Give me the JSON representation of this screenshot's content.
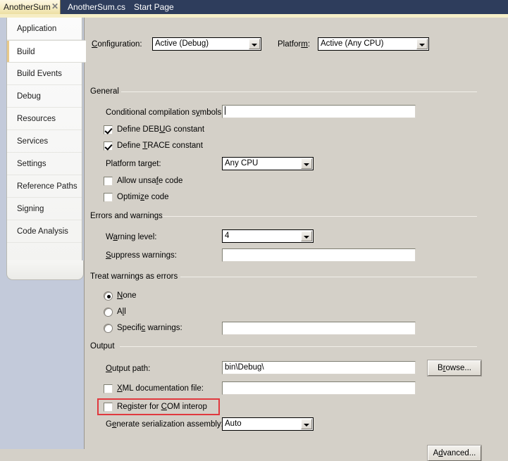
{
  "tabs": {
    "active": {
      "label": "AnotherSum",
      "close_glyph": "✕"
    },
    "others": [
      {
        "label": "AnotherSum.cs"
      },
      {
        "label": "Start Page"
      }
    ]
  },
  "sidebar": {
    "items": [
      {
        "label": "Application",
        "selected": false
      },
      {
        "label": "Build",
        "selected": true
      },
      {
        "label": "Build Events",
        "selected": false
      },
      {
        "label": "Debug",
        "selected": false
      },
      {
        "label": "Resources",
        "selected": false
      },
      {
        "label": "Services",
        "selected": false
      },
      {
        "label": "Settings",
        "selected": false
      },
      {
        "label": "Reference Paths",
        "selected": false
      },
      {
        "label": "Signing",
        "selected": false
      },
      {
        "label": "Code Analysis",
        "selected": false
      }
    ]
  },
  "config_row": {
    "configuration_label": "Configuration:",
    "configuration_value": "Active (Debug)",
    "platform_label": "Platform:",
    "platform_value": "Active (Any CPU)"
  },
  "general": {
    "header": "General",
    "conditional_symbols_label": "Conditional compilation symbols:",
    "conditional_symbols_value": "",
    "define_debug_label": "Define DEBUG constant",
    "define_debug_checked": true,
    "define_trace_label": "Define TRACE constant",
    "define_trace_checked": true,
    "platform_target_label": "Platform target:",
    "platform_target_value": "Any CPU",
    "allow_unsafe_label": "Allow unsafe code",
    "allow_unsafe_checked": false,
    "optimize_label": "Optimize code",
    "optimize_checked": false
  },
  "errors_warnings": {
    "header": "Errors and warnings",
    "warning_level_label": "Warning level:",
    "warning_level_value": "4",
    "suppress_label": "Suppress warnings:",
    "suppress_value": ""
  },
  "treat_warnings": {
    "header": "Treat warnings as errors",
    "none_label": "None",
    "all_label": "All",
    "specific_label": "Specific warnings:",
    "specific_value": "",
    "selected": "None"
  },
  "output": {
    "header": "Output",
    "output_path_label": "Output path:",
    "output_path_value": "bin\\Debug\\",
    "browse_label": "Browse...",
    "xml_doc_label": "XML documentation file:",
    "xml_doc_checked": false,
    "xml_doc_value": "",
    "com_interop_label": "Register for COM interop",
    "com_interop_checked": false,
    "serialization_label": "Generate serialization assembly:",
    "serialization_value": "Auto"
  },
  "footer": {
    "advanced_label": "Advanced..."
  },
  "colors": {
    "tabbar": "#2e3d5c",
    "active_tab": "#f6edc4",
    "panel": "#d4d0c8",
    "sidebar_backdrop": "#c3cada",
    "highlight_red": "#e0393e",
    "selection_accent": "#e8c98a"
  }
}
